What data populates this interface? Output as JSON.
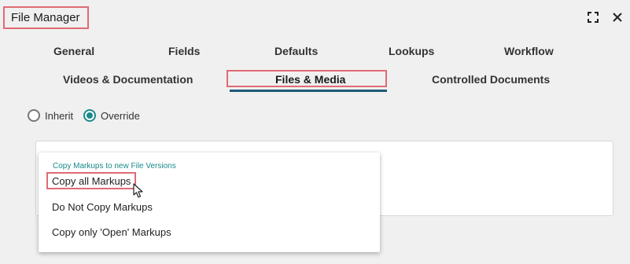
{
  "window": {
    "title": "File Manager",
    "maximize_icon": "maximize-icon",
    "close_icon": "close-icon"
  },
  "tabs": {
    "row1": [
      "General",
      "Fields",
      "Defaults",
      "Lookups",
      "Workflow"
    ],
    "row2": [
      "Videos & Documentation",
      "Files & Media",
      "Controlled Documents"
    ],
    "active": "Files & Media"
  },
  "radios": {
    "inherit_label": "Inherit",
    "override_label": "Override",
    "selected": "Override"
  },
  "dropdown": {
    "header": "Copy Markups to new File Versions",
    "options": [
      "Copy all Markups",
      "Do Not Copy Markups",
      "Copy only 'Open' Markups"
    ],
    "highlighted": "Copy all Markups"
  },
  "colors": {
    "accent": "#1a8a8a",
    "highlight_border": "#e06b74",
    "active_underline": "#1e5a78"
  }
}
